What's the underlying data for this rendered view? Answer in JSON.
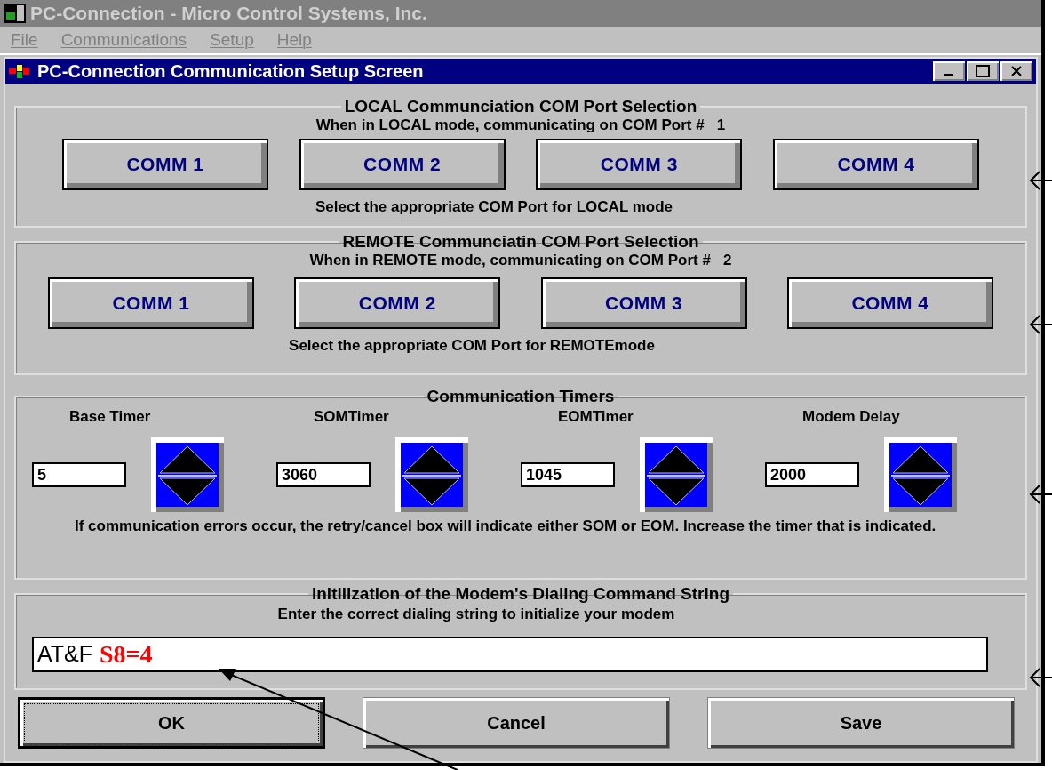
{
  "app_window": {
    "title": "PC-Connection - Micro Control Systems, Inc."
  },
  "menu": [
    "File",
    "Communications",
    "Setup",
    "Help"
  ],
  "child_window": {
    "title": "PC-Connection Communication Setup Screen"
  },
  "local_group": {
    "title": "LOCAL Communciation COM Port Selection",
    "status": "When in LOCAL mode, communicating on COM Port #   1",
    "buttons": [
      "COMM 1",
      "COMM 2",
      "COMM 3",
      "COMM 4"
    ],
    "hint": "Select the appropriate COM Port for LOCAL mode"
  },
  "remote_group": {
    "title": "REMOTE Communciatin COM Port Selection",
    "status": "When in REMOTE mode, communicating on COM Port #   2",
    "buttons": [
      "COMM 1",
      "COMM 2",
      "COMM 3",
      "COMM 4"
    ],
    "hint": "Select the appropriate COM Port for REMOTEmode"
  },
  "timers_group": {
    "title": "Communication Timers",
    "timers": [
      {
        "label": "Base Timer",
        "value": "5"
      },
      {
        "label": "SOMTimer",
        "value": "3060"
      },
      {
        "label": "EOMTimer",
        "value": "1045"
      },
      {
        "label": "Modem Delay",
        "value": "2000"
      }
    ],
    "note": "If communication errors occur, the retry/cancel box will indicate either SOM or EOM. Increase the timer that is indicated."
  },
  "modem_group": {
    "title": "Initilization of the Modem's Dialing Command String",
    "hint": "Enter the correct dialing string to initialize your modem",
    "value": "AT&F",
    "annotation": "S8=4"
  },
  "buttons": [
    {
      "label": "OK",
      "focused": true
    },
    {
      "label": "Cancel",
      "focused": false
    },
    {
      "label": "Save",
      "focused": false
    }
  ]
}
